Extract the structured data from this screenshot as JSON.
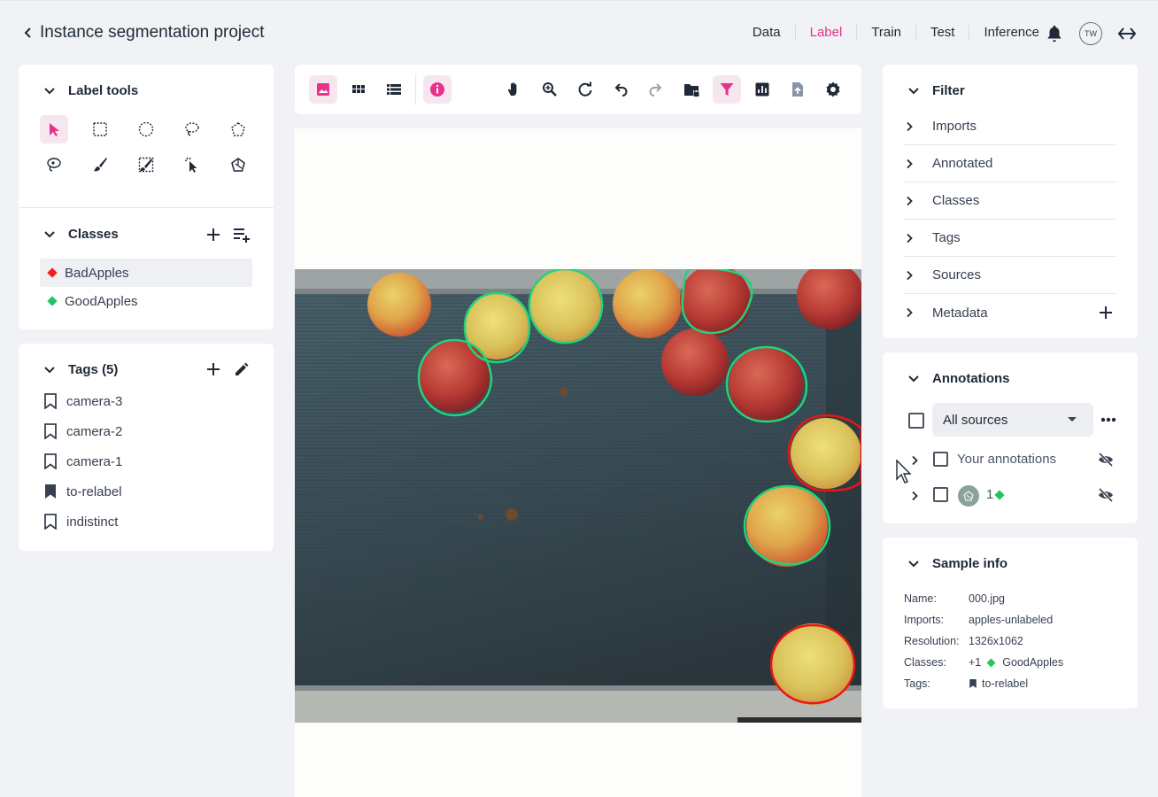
{
  "header": {
    "title": "Instance segmentation project",
    "nav": [
      "Data",
      "Label",
      "Train",
      "Test",
      "Inference"
    ],
    "active_nav": "Label",
    "avatar": "TW"
  },
  "label_tools": {
    "title": "Label tools"
  },
  "classes": {
    "title": "Classes",
    "items": [
      {
        "label": "BadApples",
        "color": "#ef1f1f"
      },
      {
        "label": "GoodApples",
        "color": "#22c55e"
      }
    ]
  },
  "tags": {
    "title": "Tags (5)",
    "items": [
      "camera-3",
      "camera-2",
      "camera-1",
      "to-relabel",
      "indistinct"
    ]
  },
  "filter": {
    "title": "Filter",
    "items": [
      "Imports",
      "Annotated",
      "Classes",
      "Tags",
      "Sources",
      "Metadata"
    ]
  },
  "annotations": {
    "title": "Annotations",
    "source_select": "All sources",
    "your_annotations": "Your annotations",
    "model_count": "1"
  },
  "sample_info": {
    "title": "Sample info",
    "name_label": "Name:",
    "name": "000.jpg",
    "imports_label": "Imports:",
    "imports": "apples-unlabeled",
    "resolution_label": "Resolution:",
    "resolution": "1326x1062",
    "classes_label": "Classes:",
    "classes_extra": "+1",
    "classes_value": "GoodApples",
    "tags_label": "Tags:",
    "tags_value": "to-relabel"
  },
  "colors": {
    "accent": "#e8318a",
    "good": "#22c55e",
    "bad": "#ef1f1f"
  }
}
